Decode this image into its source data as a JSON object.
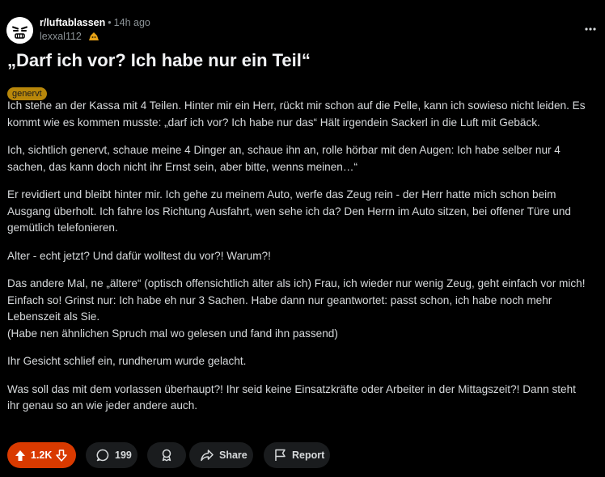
{
  "post": {
    "subreddit": "r/luftablassen",
    "separator": "•",
    "time": "14h ago",
    "author": "lexxal112",
    "title": "„Darf ich vor? Ich habe nur ein Teil“",
    "flair": "genervt",
    "paragraphs": [
      [
        "Ich stehe an der Kassa mit 4 Teilen. Hinter mir ein Herr, rückt mir schon auf die Pelle, kann ich sowieso nicht leiden. Es",
        "kommt wie es kommen musste: „darf ich vor? Ich habe nur das“ Hält irgendein Sackerl in die Luft mit Gebäck."
      ],
      [
        "Ich, sichtlich genervt, schaue meine 4 Dinger an, schaue ihn an, rolle hörbar mit den Augen: Ich habe selber nur 4",
        "sachen, das kann doch nicht ihr Ernst sein, aber bitte, wenns meinen…“"
      ],
      [
        "Er revidiert und bleibt hinter mir. Ich gehe zu meinem Auto, werfe das Zeug rein - der Herr hatte mich schon beim",
        "Ausgang überholt. Ich fahre los Richtung Ausfahrt, wen sehe ich da? Den Herrn im Auto sitzen, bei offener Türe und",
        "gemütlich telefonieren."
      ],
      [
        "Alter - echt jetzt? Und dafür wolltest du vor?! Warum?!"
      ],
      [
        "Das andere Mal, ne „ältere“ (optisch offensichtlich älter als ich) Frau, ich wieder nur wenig Zeug, geht einfach vor mich!",
        "Einfach so! Grinst nur: Ich habe eh nur 3 Sachen. Habe dann nur geantwortet: passt schon, ich habe noch mehr",
        "Lebenszeit als Sie.",
        "(Habe nen ähnlichen Spruch mal wo gelesen und fand ihn passend)"
      ],
      [
        "Ihr Gesicht schlief ein, rundherum wurde gelacht."
      ],
      [
        "Was soll das mit dem vorlassen überhaupt?! Ihr seid keine Einsatzkräfte oder Arbeiter in der Mittagszeit?! Dann steht",
        "ihr genau so an wie jeder andere auch."
      ]
    ]
  },
  "actions": {
    "upvotes": "1.2K",
    "comments": "199",
    "share_label": "Share",
    "report_label": "Report"
  },
  "colors": {
    "background": "#000000",
    "vote_active": "#d93a00",
    "flair": "#b8870a",
    "pill": "#1a1c1e"
  },
  "icons": [
    "subreddit-avatar-icon",
    "user-badge-icon",
    "more-options-icon",
    "upvote-icon",
    "downvote-icon",
    "comment-icon",
    "award-icon",
    "share-icon",
    "report-flag-icon"
  ]
}
